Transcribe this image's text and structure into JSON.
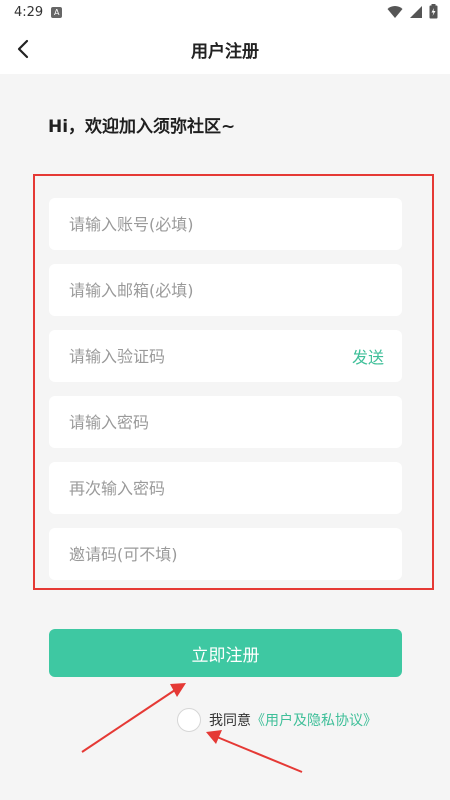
{
  "status_bar": {
    "time": "4:29",
    "notif_letter": "A"
  },
  "header": {
    "title": "用户注册"
  },
  "welcome": "Hi，欢迎加入须弥社区~",
  "form": {
    "fields": [
      {
        "placeholder": "请输入账号(必填)"
      },
      {
        "placeholder": "请输入邮箱(必填)"
      },
      {
        "placeholder": "请输入验证码",
        "action": "发送"
      },
      {
        "placeholder": "请输入密码"
      },
      {
        "placeholder": "再次输入密码"
      },
      {
        "placeholder": "邀请码(可不填)"
      }
    ]
  },
  "register_button": "立即注册",
  "agreement": {
    "text": "我同意",
    "link": "《用户及隐私协议》"
  },
  "colors": {
    "accent": "#3ec8a2",
    "annotation": "#e53935"
  }
}
